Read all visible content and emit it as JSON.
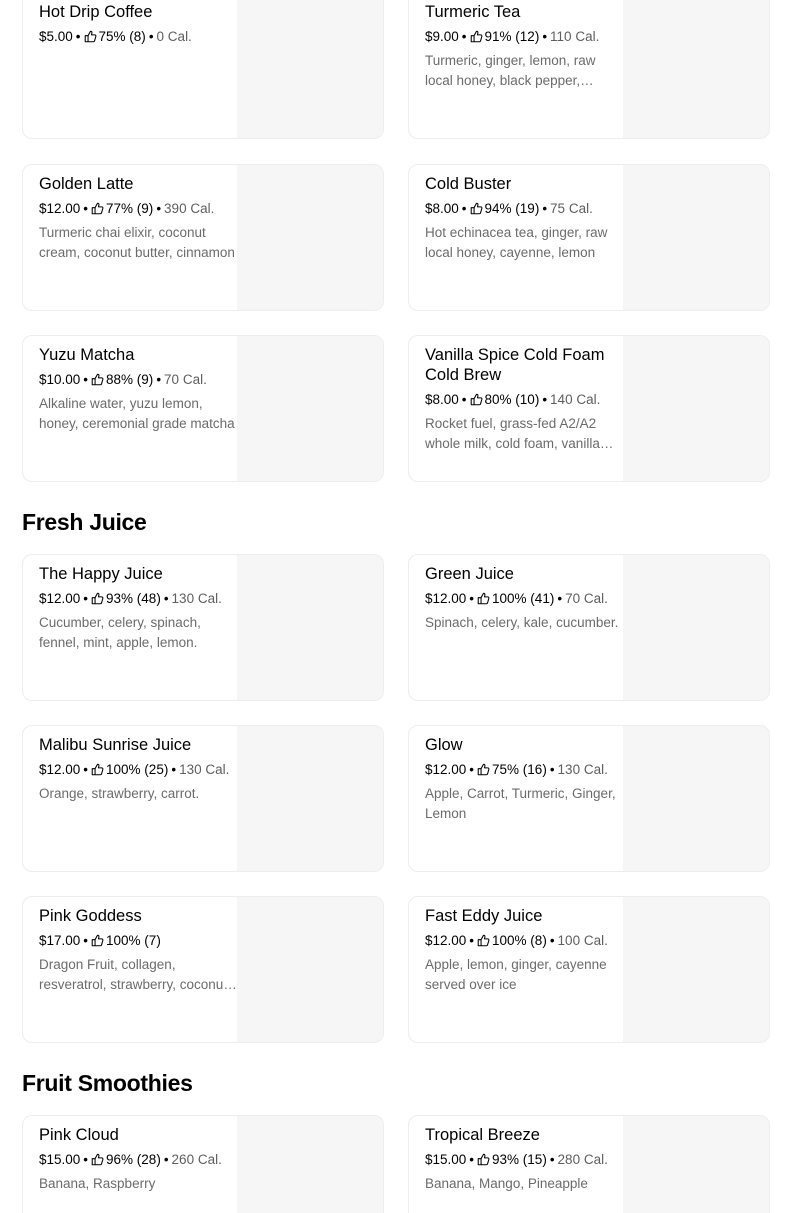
{
  "sections": [
    {
      "title": "Fresh Juice"
    },
    {
      "title": "Fruit Smoothies"
    }
  ],
  "items": [
    {
      "name": "Hot Drip Coffee",
      "price": "$5.00",
      "rating": "75% (8)",
      "cal": "0 Cal.",
      "desc": ""
    },
    {
      "name": "Turmeric Tea",
      "price": "$9.00",
      "rating": "91% (12)",
      "cal": "110 Cal.",
      "desc": "Turmeric, ginger, lemon, raw local honey, black pepper, cinnamon"
    },
    {
      "name": "Golden Latte",
      "price": "$12.00",
      "rating": "77% (9)",
      "cal": "390 Cal.",
      "desc": "Turmeric chai elixir, coconut cream, coconut butter, cinnamon"
    },
    {
      "name": "Cold Buster",
      "price": "$8.00",
      "rating": "94% (19)",
      "cal": "75 Cal.",
      "desc": "Hot echinacea tea, ginger, raw local honey, cayenne, lemon"
    },
    {
      "name": "Yuzu Matcha",
      "price": "$10.00",
      "rating": "88% (9)",
      "cal": "70 Cal.",
      "desc": "Alkaline water, yuzu lemon, honey, ceremonial grade matcha"
    },
    {
      "name": "Vanilla Spice Cold Foam Cold Brew",
      "price": "$8.00",
      "rating": "80% (10)",
      "cal": "140 Cal.",
      "desc": "Rocket fuel, grass-fed A2/A2 whole milk, cold foam, vanilla spice"
    },
    {
      "name": "The Happy Juice",
      "price": "$12.00",
      "rating": "93% (48)",
      "cal": "130 Cal.",
      "desc": "Cucumber, celery, spinach, fennel, mint, apple, lemon."
    },
    {
      "name": "Green Juice",
      "price": "$12.00",
      "rating": "100% (41)",
      "cal": "70 Cal.",
      "desc": "Spinach, celery, kale, cucumber."
    },
    {
      "name": "Malibu Sunrise Juice",
      "price": "$12.00",
      "rating": "100% (25)",
      "cal": "130 Cal.",
      "desc": "Orange, strawberry, carrot."
    },
    {
      "name": "Glow",
      "price": "$12.00",
      "rating": "75% (16)",
      "cal": "130 Cal.",
      "desc": "Apple, Carrot, Turmeric, Ginger, Lemon"
    },
    {
      "name": "Pink Goddess",
      "price": "$17.00",
      "rating": "100% (7)",
      "cal": "",
      "desc": "Dragon Fruit, collagen, resveratrol, strawberry, coconut water"
    },
    {
      "name": "Fast Eddy Juice",
      "price": "$12.00",
      "rating": "100% (8)",
      "cal": "100 Cal.",
      "desc": "Apple, lemon, ginger, cayenne served over ice"
    },
    {
      "name": "Pink Cloud",
      "price": "$15.00",
      "rating": "96% (28)",
      "cal": "260 Cal.",
      "desc": "Banana, Raspberry"
    },
    {
      "name": "Tropical Breeze",
      "price": "$15.00",
      "rating": "93% (15)",
      "cal": "280 Cal.",
      "desc": "Banana, Mango, Pineapple"
    }
  ]
}
